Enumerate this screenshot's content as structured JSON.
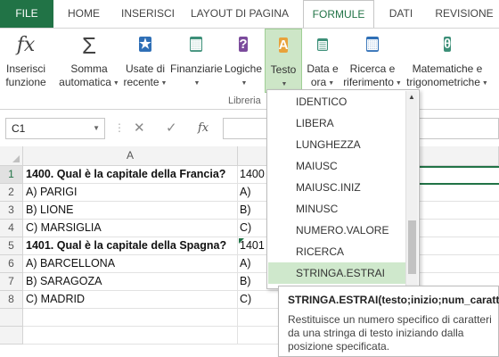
{
  "tabs": [
    {
      "label": "FILE"
    },
    {
      "label": "HOME"
    },
    {
      "label": "INSERISCI"
    },
    {
      "label": "LAYOUT DI PAGINA"
    },
    {
      "label": "FORMULE"
    },
    {
      "label": "DATI"
    },
    {
      "label": "REVISIONE"
    }
  ],
  "ribbon": {
    "insert_function": {
      "line1": "Inserisci",
      "line2": "funzione",
      "icon": "fx"
    },
    "autosum": {
      "line1": "Somma",
      "line2": "automatica",
      "icon": "Σ"
    },
    "recent": {
      "line1": "Usate di",
      "line2": "recente"
    },
    "financial": {
      "line1": "Finanziarie"
    },
    "logical": {
      "line1": "Logiche",
      "icon_text": "?"
    },
    "text": {
      "line1": "Testo",
      "icon_text": "A"
    },
    "datetime": {
      "line1": "Data e",
      "line2": "ora"
    },
    "lookup": {
      "line1": "Ricerca e",
      "line2": "riferimento"
    },
    "math": {
      "line1": "Matematiche e",
      "line2": "trigonometriche",
      "icon_text": "θ"
    },
    "group_label": "Libreria",
    "colors": {
      "green": "#217346",
      "purple": "#7b4b9c",
      "orange": "#e8a23b",
      "blue": "#2f6fb6",
      "teal": "#3c8f78"
    }
  },
  "formula_bar": {
    "name_box": "C1",
    "cancel": "✕",
    "enter": "✓",
    "fx": "fx"
  },
  "grid": {
    "col_a": "A",
    "rows": [
      {
        "num": "1",
        "a": "1400. Qual è la capitale della Francia?",
        "b": "1400",
        "bold": true
      },
      {
        "num": "2",
        "a": "A) PARIGI",
        "b": "A)",
        "bold": false
      },
      {
        "num": "3",
        "a": "B) LIONE",
        "b": "B)",
        "bold": false
      },
      {
        "num": "4",
        "a": "C) MARSIGLIA",
        "b": "C)",
        "bold": false
      },
      {
        "num": "5",
        "a": "1401. Qual è la capitale della Spagna?",
        "b": "1401",
        "bold": true
      },
      {
        "num": "6",
        "a": "A) BARCELLONA",
        "b": "A)",
        "bold": false
      },
      {
        "num": "7",
        "a": "B) SARAGOZA",
        "b": "B)",
        "bold": false
      },
      {
        "num": "8",
        "a": "C) MADRID",
        "b": "C)",
        "bold": false
      }
    ]
  },
  "menu": {
    "items": [
      "IDENTICO",
      "LIBERA",
      "LUNGHEZZA",
      "MAIUSC",
      "MAIUSC.INIZ",
      "MINUSC",
      "NUMERO.VALORE",
      "RICERCA",
      "STRINGA.ESTRAI"
    ],
    "highlighted_index": 8
  },
  "tooltip": {
    "title": "STRINGA.ESTRAI(testo;inizio;num_caratt)",
    "description": "Restituisce un numero specifico di caratteri da una stringa di testo iniziando dalla posizione specificata."
  }
}
